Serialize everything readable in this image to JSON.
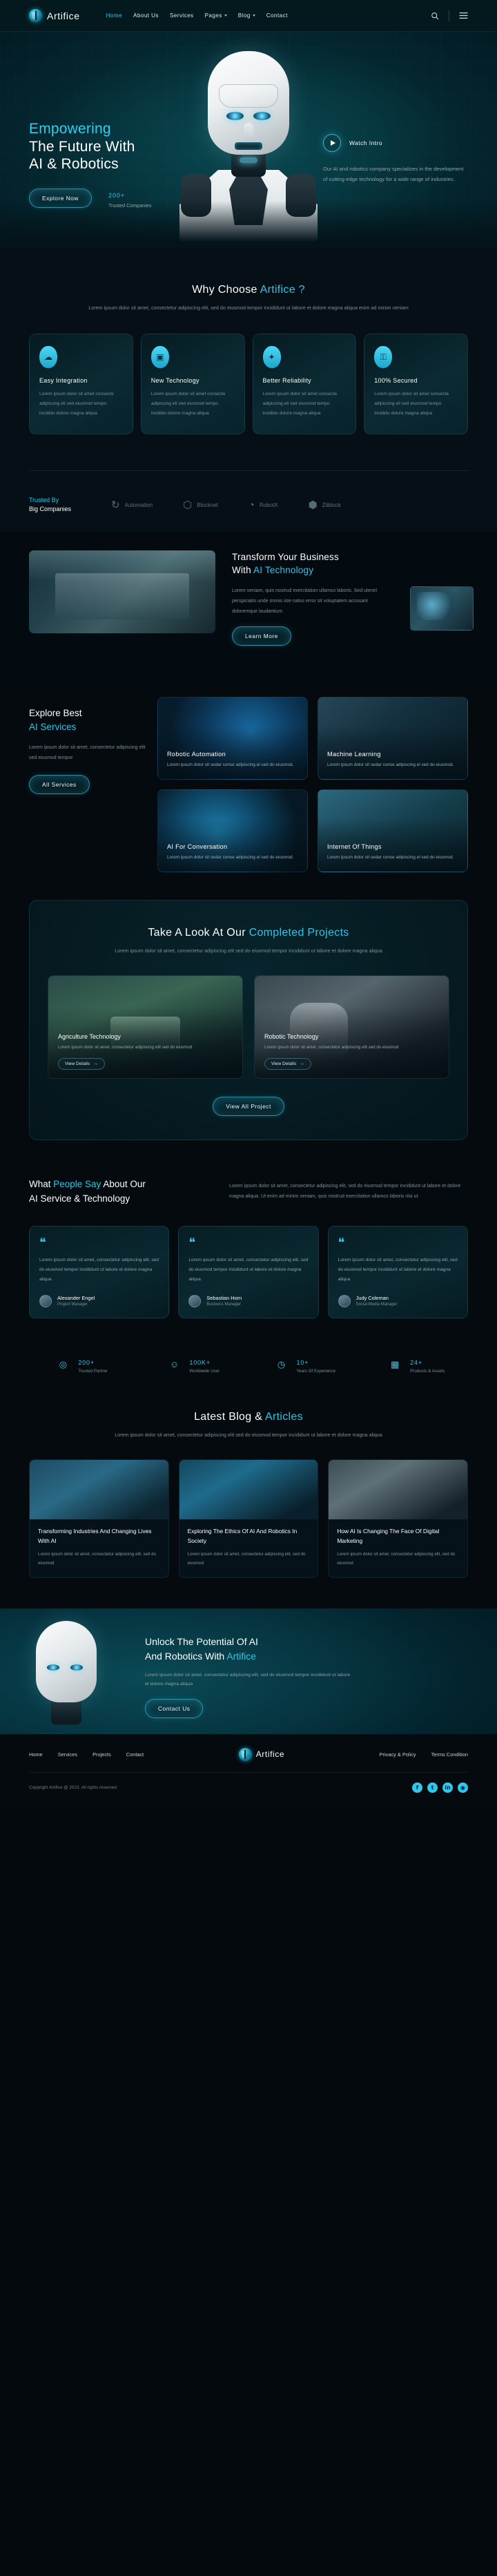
{
  "brand": {
    "name": "Artifice"
  },
  "nav": {
    "items": [
      {
        "label": "Home",
        "active": true,
        "caret": false
      },
      {
        "label": "About Us",
        "active": false,
        "caret": false
      },
      {
        "label": "Services",
        "active": false,
        "caret": false
      },
      {
        "label": "Pages",
        "active": false,
        "caret": true
      },
      {
        "label": "Blog",
        "active": false,
        "caret": true
      },
      {
        "label": "Contact",
        "active": false,
        "caret": false
      }
    ],
    "search_icon": "search-icon",
    "menu_icon": "hamburger-menu-icon"
  },
  "hero": {
    "line1": "Empowering",
    "line2": "The Future With",
    "line3": "AI & Robotics",
    "cta_label": "Explore Now",
    "stat_value": "200",
    "stat_plus": "+",
    "stat_label": "Trusted Companies",
    "watch_label": "Watch Intro",
    "description": "Our AI and robotics company specializes in the development of cutting-edge technology for a wide range of industries."
  },
  "why": {
    "title_a": "Why Choose ",
    "title_b": "Artifice ?",
    "subtitle": "Lorem ipsum dolor sit amet, consectetur adipiscing elit, sed do eiusmod tempor incididunt ut labore et dolore magna aliqua enim ad minim veniam",
    "cards": [
      {
        "icon": "cloud-integration-icon",
        "glyph": "☁",
        "title": "Easy Integration",
        "text": "Lorem ipsum dolor sit amet consecte adipiscing eli sed eiusmod tempo incididu dolore magna aliqua"
      },
      {
        "icon": "chip-technology-icon",
        "glyph": "▣",
        "title": "New Technology",
        "text": "Lorem ipsum dolor sit amet consecte adipiscing eli sed eiusmod tempo incididu dolore magna aliqua"
      },
      {
        "icon": "award-badge-icon",
        "glyph": "✦",
        "title": "Better Reliability",
        "text": "Lorem ipsum dolor sit amet consecte adipiscing eli sed eiusmod tempo incididu dolore magna aliqua"
      },
      {
        "icon": "lock-secured-icon",
        "glyph": "⚿",
        "title": "100% Secured",
        "text": "Lorem ipsum dolor sit amet consecte adipiscing eli sed eiusmod tempo incididu dolore magna aliqua"
      }
    ]
  },
  "trusted": {
    "lead_a": "Trusted By",
    "lead_b": "Big Companies",
    "logos": [
      {
        "name": "Automation",
        "glyph": "↻"
      },
      {
        "name": "Blocknet",
        "glyph": "⬡"
      },
      {
        "name": "RobotX",
        "glyph": "◔"
      },
      {
        "name": "Ziiblock",
        "glyph": "⬢"
      }
    ]
  },
  "transform": {
    "title_a": "Transform Your Business",
    "title_b": "With ",
    "title_c": "AI Technology",
    "text": "Lorem veniam, quis nostrud exercitation ullamco laboris. Sed uteniri perspiciatis unde omnis iste natus error sit voluptatem accusant doloremque laudantium",
    "cta_label": "Learn More"
  },
  "services": {
    "title_a": "Explore Best",
    "title_b": "AI Services",
    "text": "Lorem ipsum dolor sit amet, consectetur adipiscing elit sed eiusmod tempor",
    "cta_label": "All Services",
    "cards": [
      {
        "name": "Robotic Automation",
        "text": "Lorem ipsum dolor sit sedar conse adipiscing el sed do eiusmod."
      },
      {
        "name": "Machine Learning",
        "text": "Lorem ipsum dolor sit sedar conse adipiscing el sed do eiusmod."
      },
      {
        "name": "AI For Conversation",
        "text": "Lorem ipsum dolor sit sedar conse adipiscing el sed do eiusmod."
      },
      {
        "name": "Internet Of Things",
        "text": "Lorem ipsum dolor sit sedar conse adipiscing el sed do eiusmod."
      }
    ]
  },
  "projects": {
    "title_a": "Take A Look At Our ",
    "title_b": "Completed Projects",
    "subtitle": "Lorem ipsum dolor sit amet, consectetur adipiscing elit sed do eiusmod tempor incididunt ut labore et dolore magna aliqua",
    "cards": [
      {
        "name": "Agriculture Technology",
        "text": "Lorem ipsum dolor sit amet, consectetur adipiscing elit sed do eiusmod",
        "link": "View Details"
      },
      {
        "name": "Robotic Technology",
        "text": "Lorem ipsum dolor sit amet, consectetur adipiscing elit sed do eiusmod",
        "link": "View Details"
      }
    ],
    "cta_label": "View All Project"
  },
  "testimonials": {
    "title_a": "What ",
    "title_b": "People Say",
    "title_c": " About Our",
    "title_d": "AI Service & Technology",
    "text": "Lorem ipsum dolor sit amet, consectetur adipiscing elit, sed do eiusmod tempor incididunt ut labore et dolore magna aliqua. Ut enim ad minim veniam, quis nostrud exercitation ullamco laboris nisi ut",
    "cards": [
      {
        "quote": "Lorem ipsum dolor sit amet, consectetur adipiscing elit, sed do eiusmod tempor incididunt ut labore et dolore magna aliqua",
        "name": "Alexander Engel",
        "role": "Project Manager"
      },
      {
        "quote": "Lorem ipsum dolor sit amet, consectetur adipiscing elit, sed do eiusmod tempor incididunt ut labore et dolore magna aliqua",
        "name": "Sebastian Horn",
        "role": "Business Manager"
      },
      {
        "quote": "Lorem ipsum dolor sit amet, consectetur adipiscing elit, sed do eiusmod tempor incididunt ut labore et dolore magna aliqua",
        "name": "Judy Coleman",
        "role": "Social Media Manager"
      }
    ]
  },
  "counters": [
    {
      "icon": "globe-icon",
      "glyph": "◎",
      "value": "200",
      "plus": "+",
      "label": "Trusted Partner"
    },
    {
      "icon": "users-icon",
      "glyph": "☺",
      "value": "100K",
      "plus": "+",
      "label": "Worldwide User"
    },
    {
      "icon": "clock-icon",
      "glyph": "◷",
      "value": "10",
      "plus": "+",
      "label": "Years Of Experience"
    },
    {
      "icon": "box-icon",
      "glyph": "▦",
      "value": "24",
      "plus": "+",
      "label": "Products & Assets"
    }
  ],
  "blog": {
    "title_a": "Latest Blog & ",
    "title_b": "Articles",
    "subtitle": "Lorem ipsum dolor sit amet, consectetur adipiscing elit sed do eiusmod tempor incididunt ut labore et dolore magna aliqua",
    "cards": [
      {
        "title": "Transforming Industries And Changing Lives With AI",
        "text": "Lorem ipsum dolor sit amet, consectetur adipiscing elit, sed do eiusmod"
      },
      {
        "title": "Exploring The Ethics Of AI And Robotics In Society",
        "text": "Lorem ipsum dolor sit amet, consectetur adipiscing elit, sed do eiusmod"
      },
      {
        "title": "How AI Is Changing The Face Of Digital Marketing",
        "text": "Lorem ipsum dolor sit amet, consectetur adipiscing elit, sed do eiusmod"
      }
    ]
  },
  "cta": {
    "title_a": "Unlock The Potential Of AI",
    "title_b": "And Robotics With ",
    "title_c": "Artifice",
    "text": "Lorem ipsum dolor sit amet, consectetur adipiscing elit, sed do eiusmod tempor incididunt ut labore et dolore magna aliqua",
    "button": "Contact Us"
  },
  "footer": {
    "links": [
      "Home",
      "Services",
      "Projects",
      "Contact"
    ],
    "brand": "Artifice",
    "legal": [
      "Privacy & Policy",
      "Terms Condition"
    ],
    "copyright": "Copyright Artifice @ 2023. All rights reserved",
    "socials": [
      {
        "name": "facebook-icon",
        "glyph": "f"
      },
      {
        "name": "twitter-icon",
        "glyph": "t"
      },
      {
        "name": "linkedin-icon",
        "glyph": "in"
      },
      {
        "name": "instagram-icon",
        "glyph": "◉"
      }
    ]
  }
}
